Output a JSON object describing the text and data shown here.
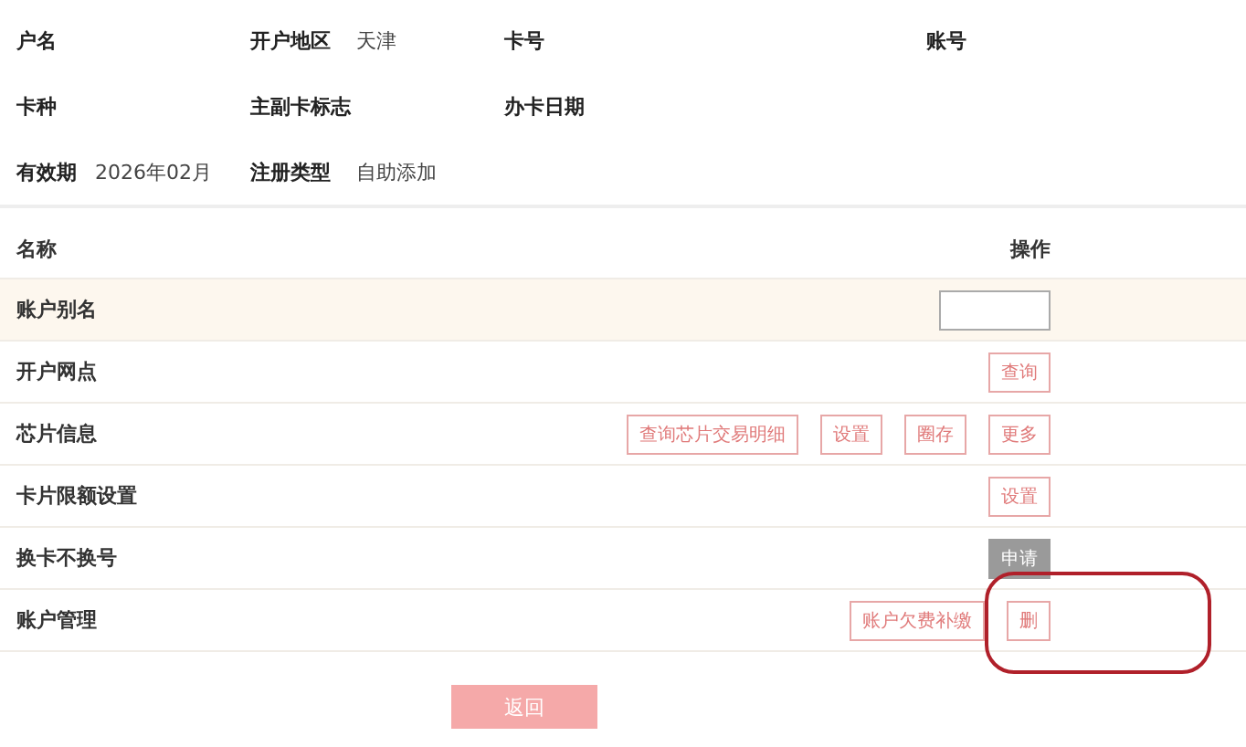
{
  "info": [
    [
      {
        "label": "户名"
      },
      {
        "label": "开户地区",
        "value": "天津"
      },
      {
        "label": "卡号"
      },
      {
        "label": "账号"
      }
    ],
    [
      {
        "label": "卡种"
      },
      {
        "label": "主副卡标志"
      },
      {
        "label": "办卡日期"
      }
    ],
    [
      {
        "label": "有效期",
        "value": "2026年02月"
      },
      {
        "label": "注册类型",
        "value": "自助添加"
      }
    ]
  ],
  "table": {
    "columns": [
      "名称",
      "操作"
    ],
    "rows": [
      {
        "name": "账户别名",
        "highlighted": true,
        "actions": [
          {
            "kind": "input"
          }
        ]
      },
      {
        "name": "开户网点",
        "highlighted": false,
        "actions": [
          {
            "kind": "button",
            "label": "查询",
            "disabled": false
          }
        ]
      },
      {
        "name": "芯片信息",
        "highlighted": false,
        "actions": [
          {
            "kind": "button",
            "label": "查询芯片交易明细",
            "disabled": false
          },
          {
            "kind": "button",
            "label": "设置",
            "disabled": false
          },
          {
            "kind": "button",
            "label": "圈存",
            "disabled": false
          },
          {
            "kind": "button",
            "label": "更多",
            "disabled": false
          }
        ]
      },
      {
        "name": "卡片限额设置",
        "highlighted": false,
        "actions": [
          {
            "kind": "button",
            "label": "设置",
            "disabled": false
          }
        ]
      },
      {
        "name": "换卡不换号",
        "highlighted": false,
        "actions": [
          {
            "kind": "button",
            "label": "申请",
            "disabled": true
          }
        ]
      },
      {
        "name": "账户管理",
        "highlighted": false,
        "actions": [
          {
            "kind": "button",
            "label": "账户欠费补缴",
            "disabled": false
          },
          {
            "kind": "button",
            "label": "删",
            "disabled": false,
            "circled": true
          }
        ]
      }
    ]
  },
  "back_button": "返回"
}
